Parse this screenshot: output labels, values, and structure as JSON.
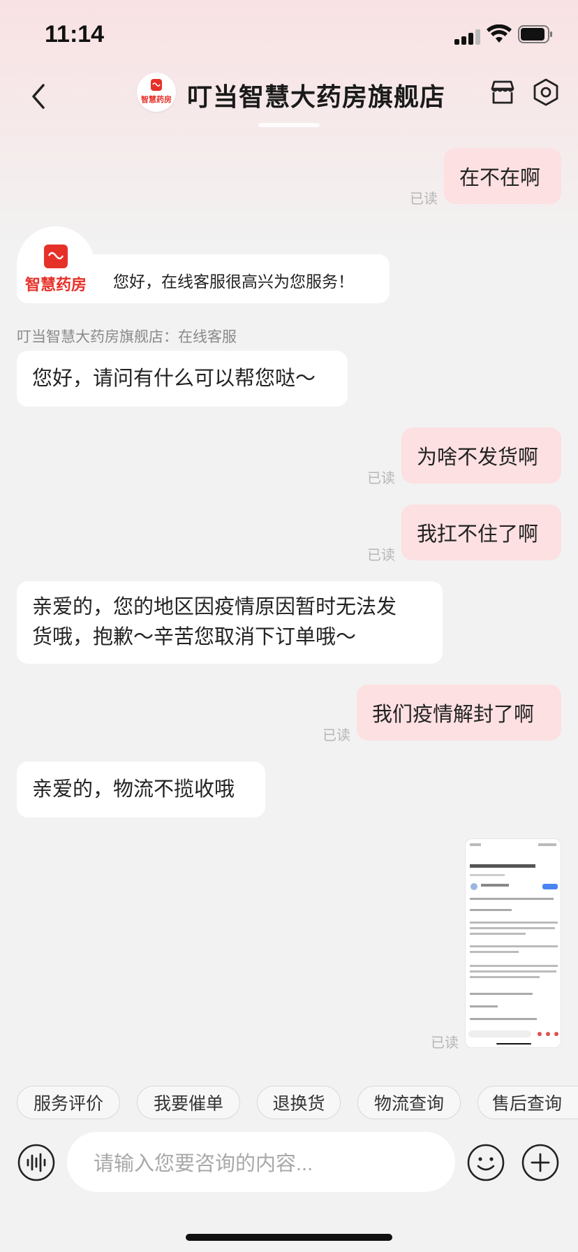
{
  "status_bar": {
    "time": "11:14"
  },
  "header": {
    "title": "叮当智慧大药房旗舰店",
    "logo_text": "智慧药房"
  },
  "welcome": {
    "logo_text": "智慧药房",
    "text": "您好，在线客服很高兴为您服务！"
  },
  "agent_label": "叮当智慧大药房旗舰店：在线客服",
  "read_label": "已读",
  "messages": [
    {
      "side": "right",
      "text": "在不在啊"
    },
    {
      "side": "left",
      "text": "您好，请问有什么可以帮您哒～"
    },
    {
      "side": "right",
      "text": "为啥不发货啊"
    },
    {
      "side": "right",
      "text": "我扛不住了啊"
    },
    {
      "side": "left",
      "line1": "亲爱的，您的地区因疫情原因暂时无法发",
      "line2": "货哦，抱歉～辛苦您取消下订单哦～"
    },
    {
      "side": "right",
      "text": "我们疫情解封了啊"
    },
    {
      "side": "left",
      "text": "亲爱的，物流不揽收哦"
    }
  ],
  "quick_replies": [
    "服务评价",
    "我要催单",
    "退换货",
    "物流查询",
    "售后查询"
  ],
  "input": {
    "placeholder": "请输入您要咨询的内容..."
  },
  "colors": {
    "brand_red": "#e63129",
    "outgoing_bubble": "#fde0e2",
    "incoming_bubble": "#ffffff",
    "background": "#f2f2f2"
  },
  "icons": [
    "back-arrow-icon",
    "store-icon",
    "settings-hexagon-icon",
    "voice-icon",
    "emoji-icon",
    "plus-icon"
  ]
}
